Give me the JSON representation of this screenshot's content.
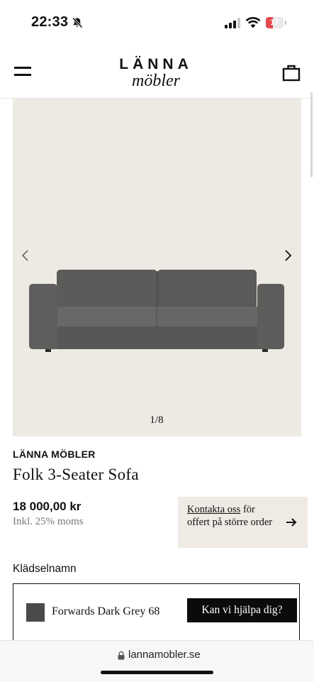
{
  "status_bar": {
    "time": "22:33",
    "battery": "17",
    "battery_level": 0.17,
    "battery_color": "#e5484d"
  },
  "header": {
    "logo_top": "LÄNNA",
    "logo_bottom": "möbler"
  },
  "gallery": {
    "counter": "1/8"
  },
  "product": {
    "brand": "LÄNNA MÖBLER",
    "title": "Folk 3-Seater Sofa",
    "price": "18 000,00 kr",
    "vat_note": "Inkl. 25% moms"
  },
  "contact": {
    "link": "Kontakta oss",
    "text": " för offert på större order"
  },
  "fabric": {
    "label": "Klädselnamn",
    "selected": "Forwards Dark Grey 68",
    "swatch_color": "#4a4a48"
  },
  "help_button": "Kan vi hjälpa dig?",
  "browser": {
    "url": "lannamobler.se"
  },
  "colors": {
    "gallery_bg": "#ede9e3",
    "contact_bg": "#efeae4",
    "button_bg": "#0b0b0b"
  }
}
